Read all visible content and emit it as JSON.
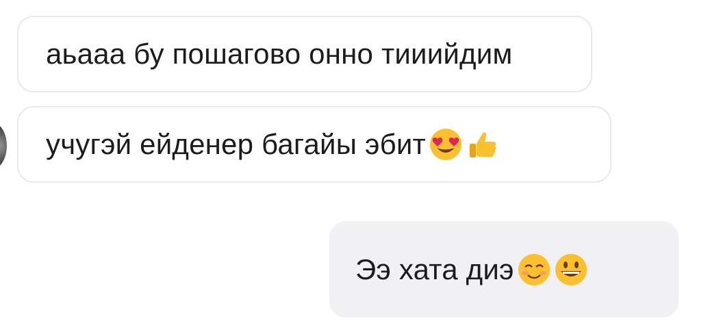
{
  "messages": [
    {
      "direction": "incoming",
      "text": "аьааа бу пошагово онно тииийдим",
      "emojis": []
    },
    {
      "direction": "incoming",
      "text": "учугэй ейденер багайы эбит",
      "emojis": [
        "heart-eyes-emoji",
        "thumbs-up-emoji"
      ]
    },
    {
      "direction": "outgoing",
      "text": "Ээ хата диэ ",
      "emojis": [
        "smiling-blush-emoji",
        "grinning-emoji"
      ]
    }
  ],
  "colors": {
    "incoming_bg": "#ffffff",
    "incoming_border": "#e9e9ed",
    "outgoing_bg": "#f1f1f3",
    "text": "#1c1c1e",
    "emoji_yellow": "#fbc02d"
  }
}
